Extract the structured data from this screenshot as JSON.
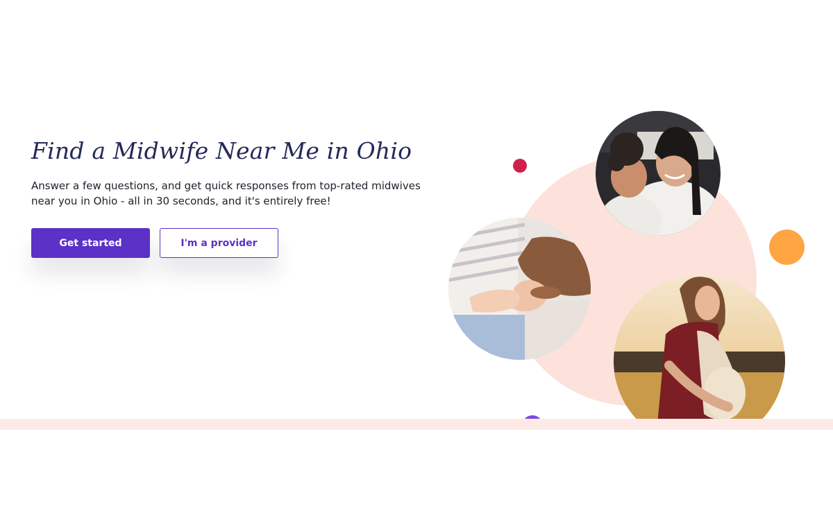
{
  "hero": {
    "title": "Find a Midwife Near Me in Ohio",
    "subtitle": "Answer a few questions, and get quick responses from top-rated midwives near you in Ohio - all in 30 seconds, and it's entirely free!",
    "primary_cta": "Get started",
    "secondary_cta": "I'm a provider"
  },
  "colors": {
    "title": "#232a57",
    "accent_purple": "#5b31c8",
    "blob_pink": "#fde2dc",
    "dot_red": "#d11f4b",
    "dot_orange": "#ffa543",
    "dot_purple": "#7a4be0",
    "band_pink": "#fde9e5"
  },
  "images": [
    {
      "name": "mother-daughter-photo"
    },
    {
      "name": "baby-hand-photo"
    },
    {
      "name": "pregnant-woman-photo"
    }
  ]
}
